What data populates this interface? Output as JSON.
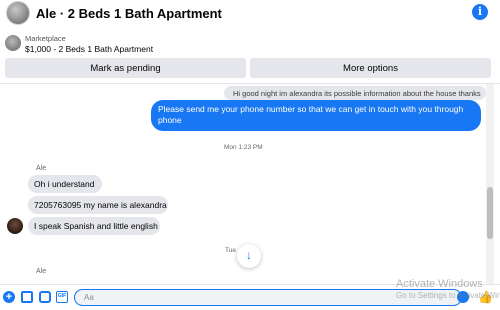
{
  "header": {
    "title": "Ale · 2 Beds 1 Bath Apartment",
    "info_icon": "info-icon"
  },
  "listing": {
    "source": "Marketplace",
    "name": "$1,000 - 2 Beds 1 Bath Apartment"
  },
  "actions": {
    "mark_pending": "Mark as pending",
    "more_options": "More options"
  },
  "thread": {
    "previous_message": "Hi good night im alexandra its possible information about the house thanks",
    "outgoing_message": "Please send me your phone  number so that we can get in touch with you through phone",
    "timestamp_1": "Mon 1:23 PM",
    "sender_1": "Ale",
    "incoming": [
      "Oh i understand",
      "7205763095 my name is alexandra",
      "I speak Spanish and little english"
    ],
    "timestamp_2": "Tue",
    "sender_2": "Ale",
    "scroll_down_icon": "arrow-down-icon"
  },
  "composer": {
    "placeholder": "Aa",
    "icons": [
      "plus-icon",
      "image-icon",
      "sticker-icon",
      "gif-icon",
      "emoji-icon",
      "like-icon"
    ]
  },
  "watermark": {
    "line1": "Activate Windows",
    "line2": "Go to Settings to activate Windows."
  },
  "colors": {
    "accent": "#1877f2",
    "bubble_in": "#e4e6eb",
    "timestamp": "#65676b"
  }
}
